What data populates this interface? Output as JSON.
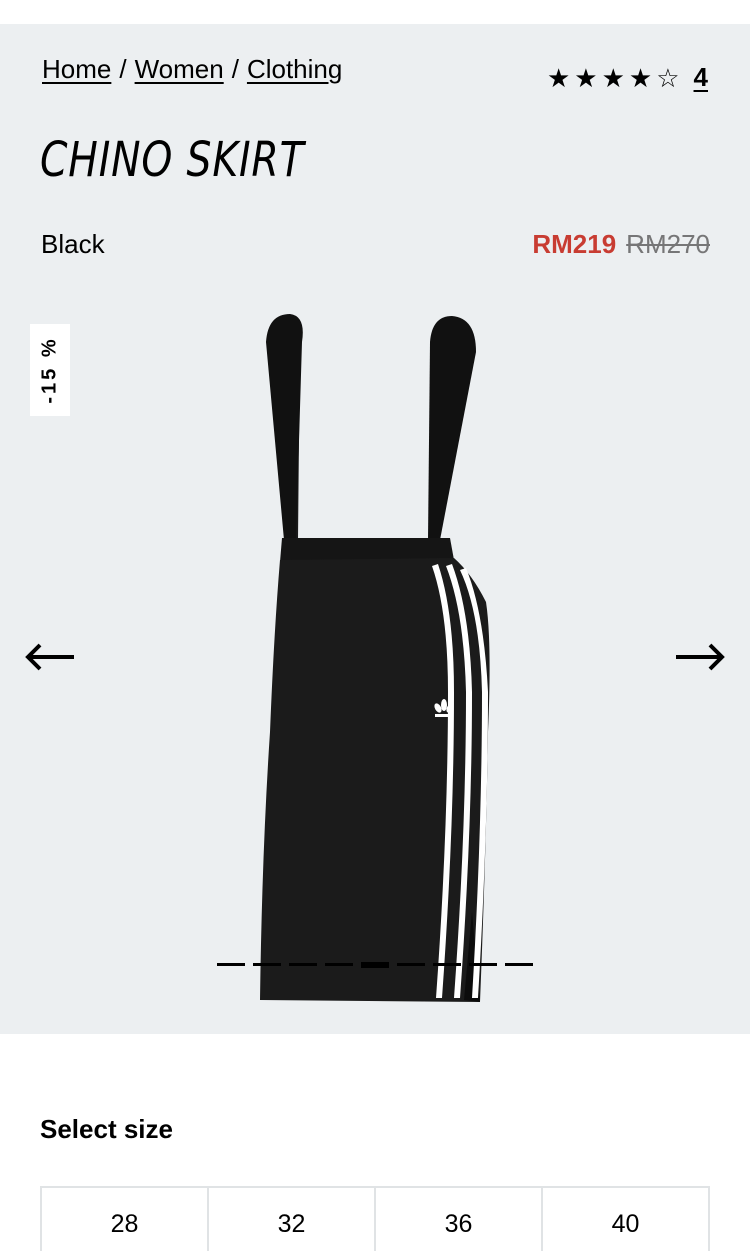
{
  "breadcrumb": {
    "home": "Home",
    "women": "Women",
    "clothing": "Clothing",
    "separator": "/"
  },
  "rating": {
    "stars": [
      "★",
      "★",
      "★",
      "★",
      "☆"
    ],
    "value": 4.5,
    "count": "4"
  },
  "product": {
    "title": "CHINO SKIRT",
    "color": "Black",
    "price_sale": "RM219",
    "price_original": "RM270",
    "discount_badge": "-15 %"
  },
  "gallery": {
    "image_count": 9,
    "active_index": 4,
    "prev_icon": "arrow-left-icon",
    "next_icon": "arrow-right-icon"
  },
  "sizes": {
    "label": "Select size",
    "options": [
      "28",
      "32",
      "36",
      "40"
    ]
  },
  "colors": {
    "background": "#eceff1",
    "sale": "#c83c32",
    "original": "#767677",
    "border": "#e0e3e5"
  }
}
